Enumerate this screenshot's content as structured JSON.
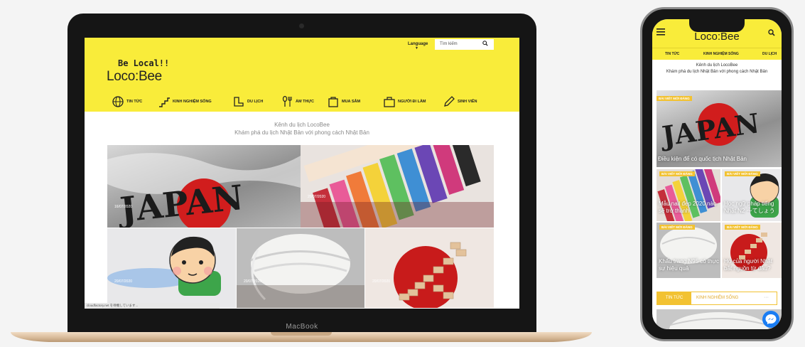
{
  "laptop": {
    "brand": "MacBook",
    "site": {
      "language_label": "Language",
      "search_placeholder": "Tìm kiếm",
      "tagline": "Be Local!!",
      "logo": "Loco:Bee",
      "nav": [
        {
          "label": "TIN TỨC",
          "icon": "globe-icon"
        },
        {
          "label": "KINH NGHIỆM SỐNG",
          "icon": "stairs-icon"
        },
        {
          "label": "DU LỊCH",
          "icon": "boot-icon"
        },
        {
          "label": "ẨM THỰC",
          "icon": "utensils-icon"
        },
        {
          "label": "MUA SẮM",
          "icon": "shopping-bag-icon"
        },
        {
          "label": "NGƯỜI ĐI LÀM",
          "icon": "briefcase-icon"
        },
        {
          "label": "SINH VIÊN",
          "icon": "pencil-icon"
        }
      ],
      "intro_line1": "Kênh du lịch LocoBee",
      "intro_line2": "Khám phá du lịch Nhật Bản với phong cách Nhật Bản",
      "tiles": [
        {
          "date": "16/07/2020",
          "image": "japan-flag-text"
        },
        {
          "date": "20/07/2020",
          "image": "nail-polish"
        },
        {
          "date": "20/07/2020",
          "image": "sleeping-cartoon"
        },
        {
          "date": "20/07/2020",
          "image": "face-mask"
        },
        {
          "date": "20/07/2020",
          "image": "japan-blocks"
        }
      ],
      "status_bar": "cloudfactory.net を待機しています..."
    }
  },
  "phone": {
    "logo": "Loco:Bee",
    "tabs": [
      "TIN TỨC",
      "KINH NGHIỆM SỐNG",
      "DU LỊCH"
    ],
    "intro_line1": "Kênh du lịch LocoBee",
    "intro_line2": "Khám phá du lịch Nhật Bản với phong cách Nhật Bản",
    "badge": "BÀI VIẾT MỚI ĐĂNG",
    "hero_caption": "Điều kiện để có quốc tịch Nhật Bản",
    "cards": [
      "Mẫu nail đẹp 2020 nào sẽ trở thành",
      "Học ngữ pháp tiếng Nhật N2 〜てしょう",
      "Khẩu trang N95 có thực sự hiệu quả",
      "Họ của người Nhật bắt nguồn từ đâu?"
    ],
    "segment": {
      "active": "TIN TỨC",
      "other": "KINH NGHIỆM SỐNG",
      "more": "···"
    }
  },
  "colors": {
    "brand_yellow": "#f9ec3a",
    "badge_yellow": "#f2c232",
    "messenger_blue": "#1a7df3"
  }
}
